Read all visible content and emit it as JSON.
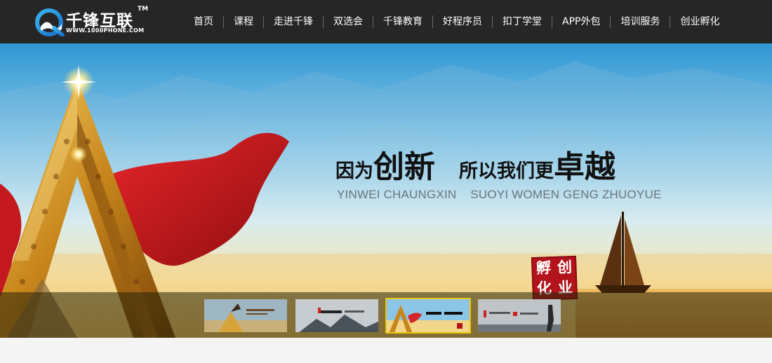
{
  "brand": {
    "name": "千锋互联",
    "tm": "TM",
    "url": "WWW.1000PHONE.COM"
  },
  "nav": {
    "items": [
      {
        "label": "首页"
      },
      {
        "label": "课程"
      },
      {
        "label": "走进千锋"
      },
      {
        "label": "双选会"
      },
      {
        "label": "千锋教育"
      },
      {
        "label": "好程序员"
      },
      {
        "label": "扣丁学堂"
      },
      {
        "label": "APP外包"
      },
      {
        "label": "培训服务"
      },
      {
        "label": "创业孵化"
      }
    ]
  },
  "banner": {
    "slogan_part1_small": "因为",
    "slogan_part1_big": "创新",
    "slogan_part2_small": "所以我们更",
    "slogan_part2_big": "卓越",
    "pinyin_part1": "YINWEI CHAUNGXIN",
    "pinyin_part2": "SUOYI WOMEN GENG ZHUOYUE",
    "seal": [
      "孵",
      "创",
      "化",
      "业"
    ]
  },
  "thumbnails": {
    "active_index": 2,
    "items": [
      {
        "name": "thumb-1"
      },
      {
        "name": "thumb-2"
      },
      {
        "name": "thumb-3"
      },
      {
        "name": "thumb-4"
      }
    ]
  },
  "colors": {
    "nav_bg": "#262626",
    "thumb_active_border": "#e8c60a",
    "seal_red": "#b3141c"
  }
}
